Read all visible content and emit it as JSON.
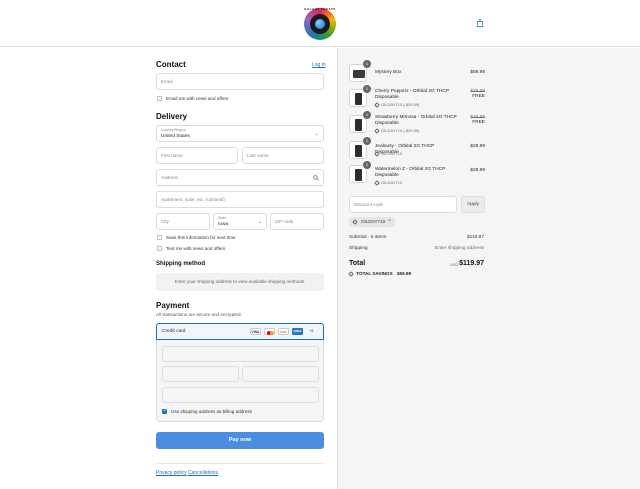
{
  "header": {
    "logo_text": "GALAXY TREATS",
    "cart_icon": "shopping-bag-icon"
  },
  "contact": {
    "title": "Contact",
    "login_link": "Log in",
    "email_placeholder": "Email",
    "news_checkbox": "Email me with news and offers"
  },
  "delivery": {
    "title": "Delivery",
    "country_label": "Country/Region",
    "country_value": "United States",
    "first_name": "First name",
    "last_name": "Last name",
    "address": "Address",
    "apartment": "Apartment, suite, etc. (optional)",
    "city": "City",
    "state_label": "State",
    "state_value": "Iowa",
    "zip": "ZIP code",
    "save_info": "Save this information for next time",
    "text_news": "Text me with news and offers"
  },
  "shipping": {
    "title": "Shipping method",
    "message": "Enter your shipping address to view available shipping methods."
  },
  "payment": {
    "title": "Payment",
    "subtitle": "All transactions are secure and encrypted.",
    "method": "Credit card",
    "brands": [
      "VISA",
      "MC",
      "DISC",
      "AMEX",
      "+6"
    ],
    "billing_same": "Use shipping address as billing address",
    "pay_button": "Pay now"
  },
  "footer": {
    "privacy": "Privacy policy",
    "cancellations": "Cancellations"
  },
  "order": {
    "items": [
      {
        "qty": "1",
        "name": "Mystery Box",
        "discount": "",
        "price": "$59.99",
        "original": ""
      },
      {
        "qty": "1",
        "name": "Cherry Popperz - Orbital 2G THCP Disposable",
        "discount": "OILDAY710 (-$29.99)",
        "price": "FREE",
        "original": "$29.99"
      },
      {
        "qty": "1",
        "name": "Strawberry Mimosa - Orbital 2G THCP Disposable",
        "discount": "OILDAY710 (-$29.99)",
        "price": "FREE",
        "original": "$29.99"
      },
      {
        "qty": "1",
        "name": "Jealousy - Orbital 2G THCP Disposable",
        "discount": "OILDAY710",
        "price": "$29.99",
        "original": ""
      },
      {
        "qty": "1",
        "name": "Watermelon Z - Orbital 2G THCP Disposable",
        "discount": "OILDAY710",
        "price": "$29.99",
        "original": ""
      }
    ],
    "discount_placeholder": "Discount code",
    "apply_label": "Apply",
    "applied_code": "OILDAY710",
    "subtotal_label": "Subtotal · 5 items",
    "subtotal_value": "$119.97",
    "shipping_label": "Shipping",
    "shipping_value": "Enter shipping address",
    "total_label": "Total",
    "currency": "USD",
    "total_value": "$119.97",
    "savings_label": "TOTAL SAVINGS",
    "savings_value": "$59.98"
  },
  "colors": {
    "accent": "#1773b0",
    "pay_button": "#4a8fdf",
    "summary_bg": "#f5f5f5"
  }
}
